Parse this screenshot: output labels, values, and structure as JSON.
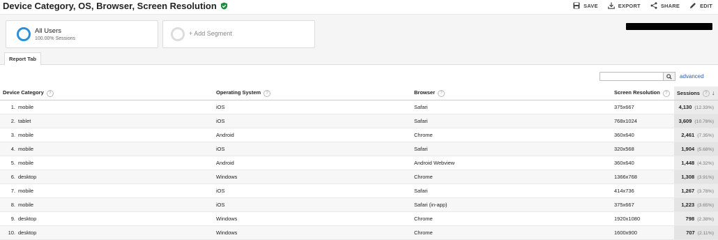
{
  "header": {
    "title": "Device Category, OS, Browser, Screen Resolution",
    "actions": [
      {
        "label": "SAVE",
        "icon": "save-icon"
      },
      {
        "label": "EXPORT",
        "icon": "export-icon"
      },
      {
        "label": "SHARE",
        "icon": "share-icon"
      },
      {
        "label": "EDIT",
        "icon": "edit-icon"
      }
    ]
  },
  "segments": {
    "active": {
      "title": "All Users",
      "subtitle": "100.00% Sessions",
      "color": "#2b8ed8"
    },
    "add_label": "+ Add Segment"
  },
  "tabs": {
    "report_tab": "Report Tab"
  },
  "tools": {
    "search_placeholder": "",
    "advanced_label": "advanced"
  },
  "table": {
    "headers": {
      "device": "Device Category",
      "os": "Operating System",
      "browser": "Browser",
      "resolution": "Screen Resolution",
      "sessions": "Sessions"
    },
    "rows": [
      {
        "index": "1.",
        "device": "mobile",
        "os": "iOS",
        "browser": "Safari",
        "resolution": "375x667",
        "sessions": "4,130",
        "pct": "(12.33%)"
      },
      {
        "index": "2.",
        "device": "tablet",
        "os": "iOS",
        "browser": "Safari",
        "resolution": "768x1024",
        "sessions": "3,609",
        "pct": "(10.78%)"
      },
      {
        "index": "3.",
        "device": "mobile",
        "os": "Android",
        "browser": "Chrome",
        "resolution": "360x640",
        "sessions": "2,461",
        "pct": "(7.35%)"
      },
      {
        "index": "4.",
        "device": "mobile",
        "os": "iOS",
        "browser": "Safari",
        "resolution": "320x568",
        "sessions": "1,904",
        "pct": "(5.68%)"
      },
      {
        "index": "5.",
        "device": "mobile",
        "os": "Android",
        "browser": "Android Webview",
        "resolution": "360x640",
        "sessions": "1,448",
        "pct": "(4.32%)"
      },
      {
        "index": "6.",
        "device": "desktop",
        "os": "Windows",
        "browser": "Chrome",
        "resolution": "1366x768",
        "sessions": "1,308",
        "pct": "(3.91%)"
      },
      {
        "index": "7.",
        "device": "mobile",
        "os": "iOS",
        "browser": "Safari",
        "resolution": "414x736",
        "sessions": "1,267",
        "pct": "(3.78%)"
      },
      {
        "index": "8.",
        "device": "mobile",
        "os": "iOS",
        "browser": "Safari (in-app)",
        "resolution": "375x667",
        "sessions": "1,223",
        "pct": "(3.65%)"
      },
      {
        "index": "9.",
        "device": "desktop",
        "os": "Windows",
        "browser": "Chrome",
        "resolution": "1920x1080",
        "sessions": "798",
        "pct": "(2.38%)"
      },
      {
        "index": "10.",
        "device": "desktop",
        "os": "Windows",
        "browser": "Chrome",
        "resolution": "1600x900",
        "sessions": "707",
        "pct": "(2.11%)"
      }
    ]
  }
}
